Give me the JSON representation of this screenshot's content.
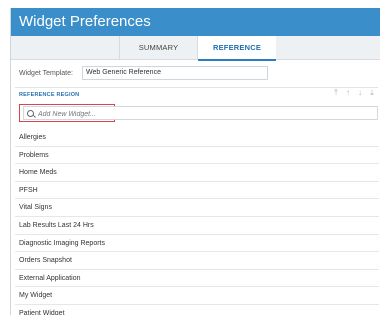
{
  "window": {
    "title": "Widget Preferences"
  },
  "tabs": [
    {
      "label": "SUMMARY",
      "active": false
    },
    {
      "label": "REFERENCE",
      "active": true
    }
  ],
  "template": {
    "label": "Widget Template:",
    "value": "Web Generic Reference"
  },
  "region": {
    "label": "REFERENCE REGION"
  },
  "search": {
    "placeholder": "Add New Widget..."
  },
  "widgets": [
    "Allergies",
    "Problems",
    "Home Meds",
    "PFSH",
    "Vital Signs",
    "Lab Results Last 24 Hrs",
    "Diagnostic Imaging Reports",
    "Orders Snapshot",
    "External Application",
    "My Widget",
    "Patient Widget"
  ],
  "colors": {
    "titlebar": "#3a8fcb",
    "active_tab": "#1f6fb0",
    "highlight": "#d8464b"
  }
}
